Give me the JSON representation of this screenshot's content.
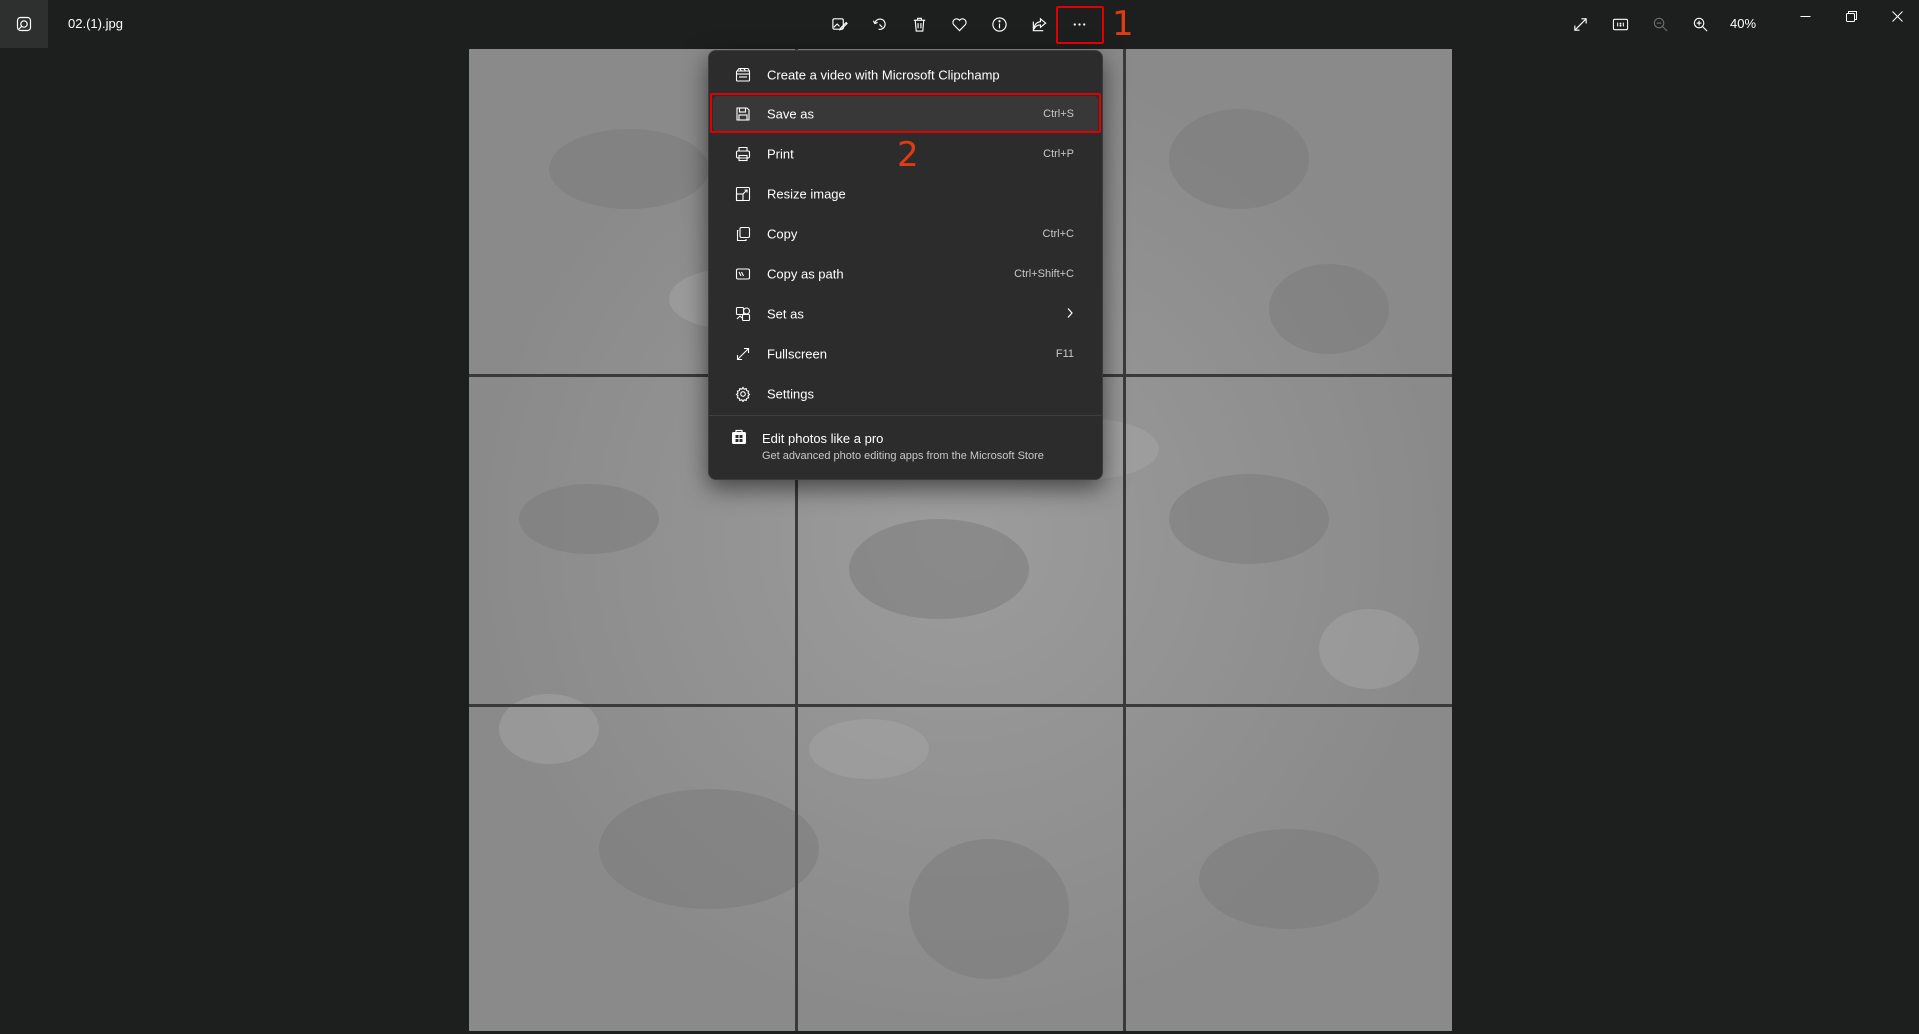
{
  "titlebar": {
    "filename": "02.(1).jpg",
    "app_icon": "photos-app-icon",
    "toolbar_icons": [
      "edit-image-icon",
      "rotate-icon",
      "delete-icon",
      "favorite-icon",
      "info-icon",
      "share-icon",
      "more-options-icon"
    ],
    "view_icons": [
      "fullscreen-icon",
      "actual-size-icon",
      "zoom-out-icon",
      "zoom-in-icon"
    ],
    "zoom_level": "40%",
    "window_icons": [
      "minimize-icon",
      "restore-icon",
      "close-icon"
    ]
  },
  "annotations": {
    "step1": "1",
    "step2": "2",
    "highlight_color": "#e00000",
    "number_color": "#e23b14"
  },
  "menu": {
    "items": [
      {
        "label": "Create a video with Microsoft Clipchamp",
        "shortcut": "",
        "icon": "clipchamp-icon"
      },
      {
        "label": "Save as",
        "shortcut": "Ctrl+S",
        "icon": "save-icon"
      },
      {
        "label": "Print",
        "shortcut": "Ctrl+P",
        "icon": "print-icon"
      },
      {
        "label": "Resize image",
        "shortcut": "",
        "icon": "resize-icon"
      },
      {
        "label": "Copy",
        "shortcut": "Ctrl+C",
        "icon": "copy-icon"
      },
      {
        "label": "Copy as path",
        "shortcut": "Ctrl+Shift+C",
        "icon": "copy-path-icon"
      },
      {
        "label": "Set as",
        "shortcut": "",
        "icon": "set-as-icon"
      },
      {
        "label": "Fullscreen",
        "shortcut": "F11",
        "icon": "fullscreen-icon"
      },
      {
        "label": "Settings",
        "shortcut": "",
        "icon": "settings-icon"
      }
    ],
    "promo": {
      "title": "Edit photos like a pro",
      "subtitle": "Get advanced photo editing apps from the Microsoft Store",
      "icon": "store-icon"
    }
  }
}
